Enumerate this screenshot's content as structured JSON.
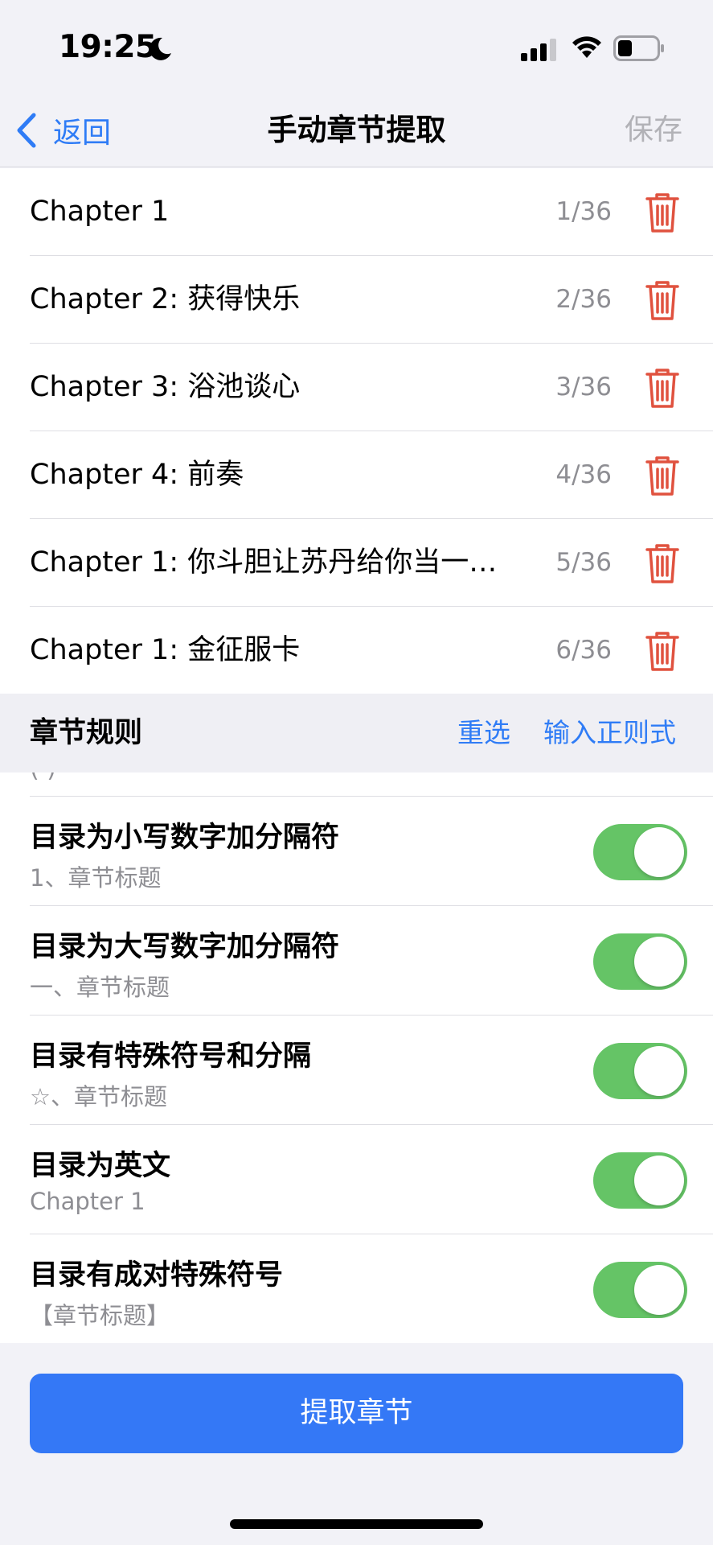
{
  "status_bar": {
    "time": "19:25",
    "moon_icon": "moon-icon",
    "signal_icon": "cellular-signal-icon",
    "wifi_icon": "wifi-icon",
    "battery_icon": "battery-icon"
  },
  "nav": {
    "back_label": "返回",
    "title": "手动章节提取",
    "save_label": "保存"
  },
  "chapters": [
    {
      "title": "Chapter 1",
      "index": "1/36"
    },
    {
      "title": "Chapter 2: 获得快乐",
      "index": "2/36"
    },
    {
      "title": "Chapter 3: 浴池谈心",
      "index": "3/36"
    },
    {
      "title": "Chapter 4: 前奏",
      "index": "4/36"
    },
    {
      "title": "Chapter 1: 你斗胆让苏丹给你当一…",
      "index": "5/36"
    },
    {
      "title": "Chapter 1: 金征服卡",
      "index": "6/36"
    }
  ],
  "rules_header": {
    "title": "章节规则",
    "reselect_label": "重选",
    "regex_label": "输入正则式"
  },
  "rules": [
    {
      "title": "目录为小写数字加分隔符",
      "example": "1、章节标题",
      "enabled": true
    },
    {
      "title": "目录为大写数字加分隔符",
      "example": "一、章节标题",
      "enabled": true
    },
    {
      "title": "目录有特殊符号和分隔",
      "example": "☆、章节标题",
      "enabled": true
    },
    {
      "title": "目录为英文",
      "example": "Chapter 1",
      "enabled": true
    },
    {
      "title": "目录有成对特殊符号",
      "example": "【章节标题】",
      "enabled": true
    }
  ],
  "extract_button": {
    "label": "提取章节"
  },
  "colors": {
    "accent": "#3478f6",
    "link": "#2f7cf6",
    "toggle_on": "#65c466",
    "delete": "#e0523f",
    "secondary_text": "#8e8e93"
  }
}
